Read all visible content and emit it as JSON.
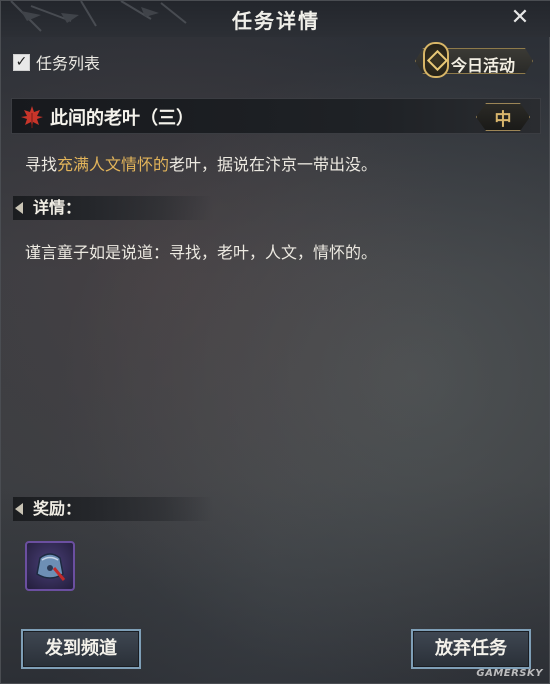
{
  "window": {
    "title": "任务详情",
    "close_icon": "close-icon"
  },
  "toolbar": {
    "task_list_checked": true,
    "task_list_label": "任务列表",
    "today_activity_label": "今日活动"
  },
  "quest": {
    "title": "此间的老叶（三）",
    "difficulty": "中",
    "desc_prefix": "寻找",
    "desc_highlight": "充满人文情怀的",
    "desc_suffix": "老叶，据说在汴京一带出没。"
  },
  "details": {
    "heading": "详情：",
    "text": "谨言童子如是说道：寻找，老叶，人文，情怀的。"
  },
  "reward": {
    "heading": "奖励：",
    "items": [
      {
        "icon": "bell-pouch-icon"
      }
    ]
  },
  "buttons": {
    "share": "发到频道",
    "abandon": "放弃任务"
  },
  "watermark": "GAMERSKY",
  "colors": {
    "highlight": "#e2b45a",
    "difficulty": "#d8b56c",
    "button_border": "#7f9fb7",
    "reward_border": "#6b4fa0"
  }
}
